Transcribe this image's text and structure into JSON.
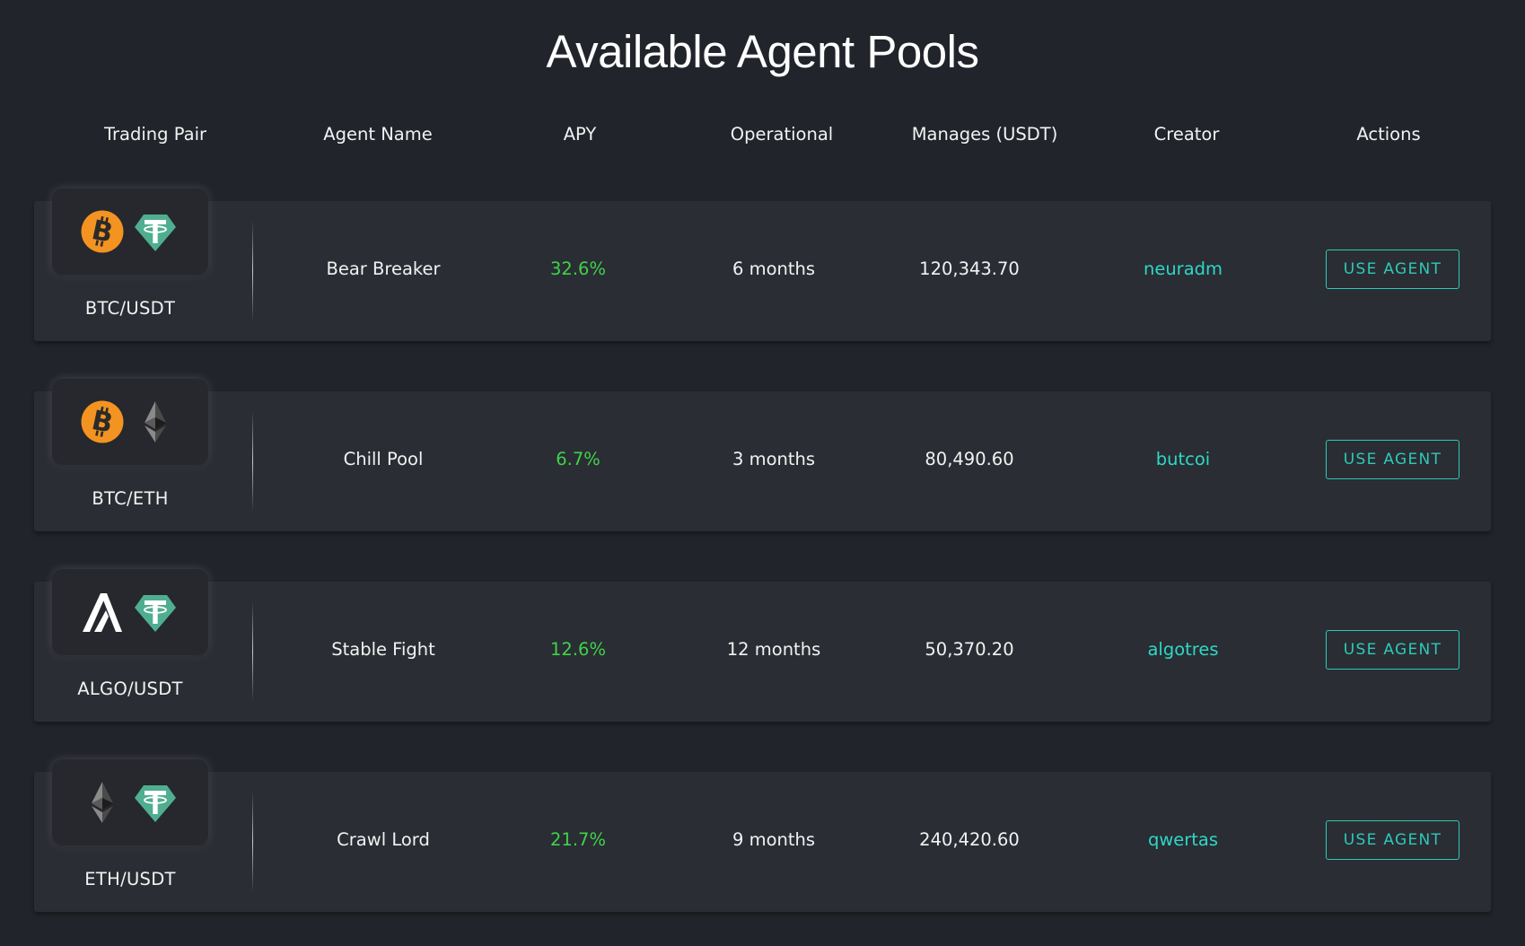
{
  "title": "Available Agent Pools",
  "columns": [
    "Trading Pair",
    "Agent Name",
    "APY",
    "Operational",
    "Manages (USDT)",
    "Creator",
    "Actions"
  ],
  "colors": {
    "apy": "#3fd24a",
    "creator": "#2dd8c8",
    "button": "#2ec9b8",
    "btc": "#f39321",
    "usdt": "#4fae8f"
  },
  "rows": [
    {
      "icons": [
        "btc-icon",
        "usdt-icon"
      ],
      "pair": "BTC/USDT",
      "agent": "Bear Breaker",
      "apy": "32.6%",
      "operational": "6 months",
      "manages": "120,343.70",
      "creator": "neuradm",
      "action": "USE AGENT"
    },
    {
      "icons": [
        "btc-icon",
        "eth-icon"
      ],
      "pair": "BTC/ETH",
      "agent": "Chill Pool",
      "apy": "6.7%",
      "operational": "3 months",
      "manages": "80,490.60",
      "creator": "butcoi",
      "action": "USE AGENT"
    },
    {
      "icons": [
        "algo-icon",
        "usdt-icon"
      ],
      "pair": "ALGO/USDT",
      "agent": "Stable Fight",
      "apy": "12.6%",
      "operational": "12 months",
      "manages": "50,370.20",
      "creator": "algotres",
      "action": "USE AGENT"
    },
    {
      "icons": [
        "eth-icon",
        "usdt-icon"
      ],
      "pair": "ETH/USDT",
      "agent": "Crawl Lord",
      "apy": "21.7%",
      "operational": "9 months",
      "manages": "240,420.60",
      "creator": "qwertas",
      "action": "USE AGENT"
    }
  ]
}
